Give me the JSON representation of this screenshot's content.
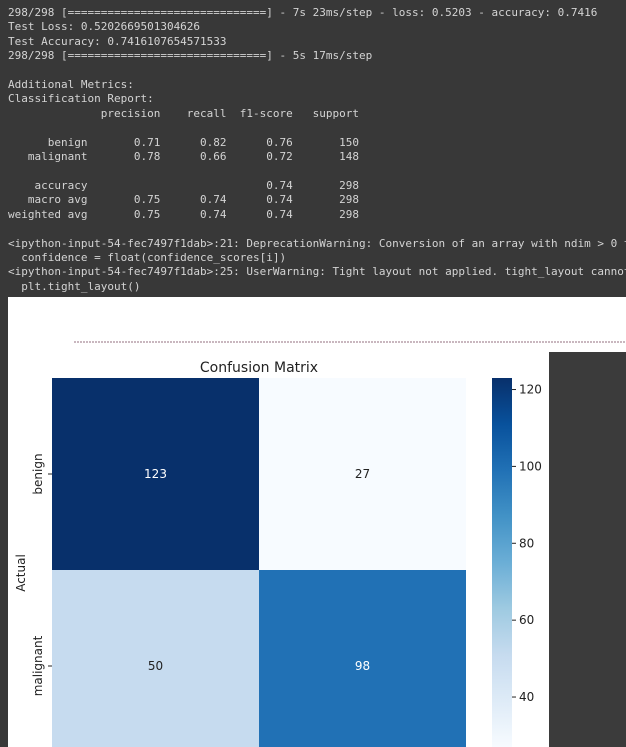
{
  "console": {
    "lines": [
      "298/298 [==============================] - 7s 23ms/step - loss: 0.5203 - accuracy: 0.7416",
      "Test Loss: 0.520266950130462б",
      "Test Accuracy: 0.7416107654571533",
      "298/298 [==============================] - 5s 17ms/step",
      "",
      "Additional Metrics:",
      "Classification Report:",
      "              precision    recall  f1-score   support",
      "",
      "      benign       0.71      0.82      0.76       150",
      "   malignant       0.78      0.66      0.72       148",
      "",
      "    accuracy                           0.74       298",
      "   macro avg       0.75      0.74      0.74       298",
      "weighted avg       0.75      0.74      0.74       298",
      "",
      "<ipython-input-54-fec7497f1dab>:21: DeprecationWarning: Conversion of an array with ndim > 0 to a",
      "  confidence = float(confidence_scores[i])",
      "<ipython-input-54-fec7497f1dab>:25: UserWarning: Tight layout not applied. tight_layout cannot ma",
      "  plt.tight_layout()"
    ]
  },
  "colors": {
    "console_bg": "#383838",
    "console_text": "#d4d4d4",
    "cell_123": "#08306b",
    "cell_27": "#f7fbff",
    "cell_50": "#c6dbef",
    "cell_98": "#2171b5"
  },
  "chart_data": {
    "type": "heatmap",
    "title": "Confusion Matrix",
    "ylabel": "Actual",
    "xlabel": "",
    "row_labels": [
      "benign",
      "malignant"
    ],
    "col_labels": [
      "",
      ""
    ],
    "values": [
      [
        123,
        27
      ],
      [
        50,
        98
      ]
    ],
    "colorbar": {
      "ticks": [
        "120",
        "100",
        "80",
        "60",
        "40"
      ],
      "tick_values": [
        120,
        100,
        80,
        60,
        40
      ],
      "min": 27,
      "max": 123,
      "colormap": "Blues"
    }
  }
}
